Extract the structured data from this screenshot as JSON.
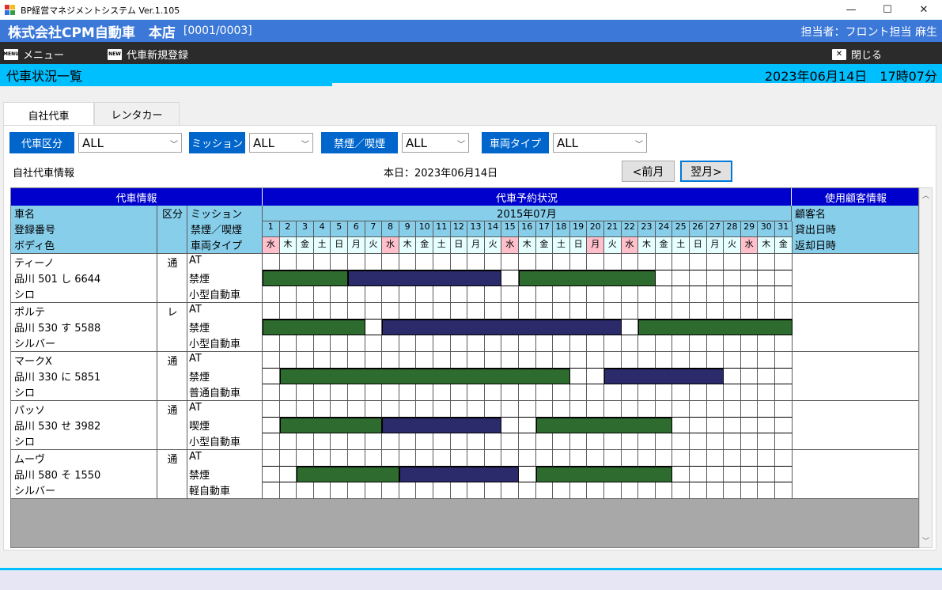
{
  "window": {
    "title": "BP経営マネジメントシステム Ver.1.105",
    "minimize": "—",
    "maximize": "☐",
    "close": "✕"
  },
  "header": {
    "company": "株式会社CPM自動車　本店",
    "code": "[0001/0003]",
    "user": "担当者：フロント担当 麻生"
  },
  "menu": {
    "menu_label": "メニュー",
    "menu_icon": "MENU",
    "new_label": "代車新規登録",
    "new_icon": "NEW",
    "close_label": "閉じる",
    "close_icon": "✕"
  },
  "screen": {
    "title": "代車状況一覧",
    "datetime": "2023年06月14日　17時07分"
  },
  "tabs": [
    "自社代車",
    "レンタカー"
  ],
  "filters": {
    "kubun_label": "代車区分",
    "kubun_value": "ALL",
    "mission_label": "ミッション",
    "mission_value": "ALL",
    "smoke_label": "禁煙／喫煙",
    "smoke_value": "ALL",
    "type_label": "車両タイプ",
    "type_value": "ALL"
  },
  "info": {
    "section_label": "自社代車情報",
    "today": "本日：2023年06月14日",
    "prev_button": "<前月",
    "next_button": "翌月>"
  },
  "grid": {
    "group_headers": {
      "car_info": "代車情報",
      "reservation": "代車予約状況",
      "customer": "使用顧客情報"
    },
    "month": "2015年07月",
    "col_car": [
      "車名",
      "登録番号",
      "ボディ色"
    ],
    "col_kubun": "区分",
    "col_mission": [
      "ミッション",
      "禁煙／喫煙",
      "車両タイプ"
    ],
    "col_customer": [
      "顧客名",
      "貸出日時",
      "返却日時"
    ],
    "days": [
      "1",
      "2",
      "3",
      "4",
      "5",
      "6",
      "7",
      "8",
      "9",
      "10",
      "11",
      "12",
      "13",
      "14",
      "15",
      "16",
      "17",
      "18",
      "19",
      "20",
      "21",
      "22",
      "23",
      "24",
      "25",
      "26",
      "27",
      "28",
      "29",
      "30",
      "31"
    ],
    "weekdays": [
      "水",
      "木",
      "金",
      "土",
      "日",
      "月",
      "火",
      "水",
      "木",
      "金",
      "土",
      "日",
      "月",
      "火",
      "水",
      "木",
      "金",
      "土",
      "日",
      "月",
      "火",
      "水",
      "木",
      "金",
      "土",
      "日",
      "月",
      "火",
      "水",
      "木",
      "金"
    ],
    "weekday_colors": [
      "#ffc0cb",
      "#e6ffff",
      "#e6ffff",
      "#e6ffff",
      "#e6ffff",
      "#e6ffff",
      "#e6ffff",
      "#ffc0cb",
      "#e6ffff",
      "#e6ffff",
      "#e6ffff",
      "#e6ffff",
      "#e6ffff",
      "#e6ffff",
      "#ffc0cb",
      "#e6ffff",
      "#e6ffff",
      "#e6ffff",
      "#e6ffff",
      "#ffc0cb",
      "#e6ffff",
      "#ffc0cb",
      "#e6ffff",
      "#e6ffff",
      "#e6ffff",
      "#e6ffff",
      "#e6ffff",
      "#e6ffff",
      "#ffc0cb",
      "#e6ffff",
      "#e6ffff"
    ],
    "cars": [
      {
        "name": "ティーノ",
        "plate": "品川 501 し 6644",
        "color": "シロ",
        "kubun": "通",
        "mission": "AT",
        "smoking": "禁煙",
        "type": "小型自動車",
        "bookings": [
          {
            "start": 1,
            "end": 5,
            "kind": "green"
          },
          {
            "start": 6,
            "end": 14,
            "kind": "navy"
          },
          {
            "start": 16,
            "end": 23,
            "kind": "green"
          }
        ]
      },
      {
        "name": "ポルテ",
        "plate": "品川 530 す 5588",
        "color": "シルバー",
        "kubun": "レ",
        "mission": "AT",
        "smoking": "禁煙",
        "type": "小型自動車",
        "bookings": [
          {
            "start": 1,
            "end": 6,
            "kind": "green"
          },
          {
            "start": 8,
            "end": 21,
            "kind": "navy"
          },
          {
            "start": 23,
            "end": 31,
            "kind": "green"
          }
        ]
      },
      {
        "name": "マークX",
        "plate": "品川 330 に 5851",
        "color": "シロ",
        "kubun": "通",
        "mission": "AT",
        "smoking": "禁煙",
        "type": "普通自動車",
        "bookings": [
          {
            "start": 2,
            "end": 18,
            "kind": "green"
          },
          {
            "start": 21,
            "end": 27,
            "kind": "navy"
          }
        ]
      },
      {
        "name": "パッソ",
        "plate": "品川 530 せ 3982",
        "color": "シロ",
        "kubun": "通",
        "mission": "AT",
        "smoking": "喫煙",
        "type": "小型自動車",
        "bookings": [
          {
            "start": 2,
            "end": 7,
            "kind": "green"
          },
          {
            "start": 8,
            "end": 14,
            "kind": "navy"
          },
          {
            "start": 17,
            "end": 24,
            "kind": "green"
          }
        ]
      },
      {
        "name": "ムーヴ",
        "plate": "品川 580 そ 1550",
        "color": "シルバー",
        "kubun": "通",
        "mission": "AT",
        "smoking": "禁煙",
        "type": "軽自動車",
        "bookings": [
          {
            "start": 3,
            "end": 8,
            "kind": "green"
          },
          {
            "start": 9,
            "end": 15,
            "kind": "navy"
          },
          {
            "start": 17,
            "end": 24,
            "kind": "green"
          }
        ]
      }
    ]
  },
  "colors": {
    "green": "#2e6b2e",
    "navy": "#2b2a6b",
    "accent": "#00bfff",
    "header_blue": "#3c78d8",
    "label_blue": "#0066cc"
  }
}
